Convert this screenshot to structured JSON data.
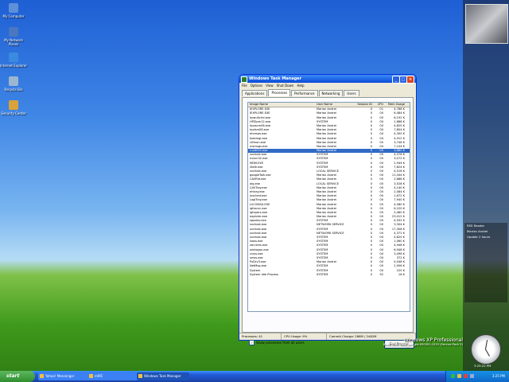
{
  "desktop_icons": [
    {
      "label": "My Computer",
      "color": "#5e8fd9"
    },
    {
      "label": "My Network Places",
      "color": "#4a77c0"
    },
    {
      "label": "Internet Explorer",
      "color": "#3a8be0"
    },
    {
      "label": "Recycle Bin",
      "color": "#9cb5d0"
    },
    {
      "label": "Security Center",
      "color": "#d9a23a"
    }
  ],
  "task_manager": {
    "title": "Windows Task Manager",
    "menu": [
      "File",
      "Options",
      "View",
      "Shut Down",
      "Help"
    ],
    "tabs": [
      "Applications",
      "Processes",
      "Performance",
      "Networking",
      "Users"
    ],
    "active_tab": "Processes",
    "columns": [
      "Image Name",
      "User Name",
      "Session ID",
      "CPU",
      "Mem Usage"
    ],
    "rows": [
      [
        "IEXPLORE.EXE",
        "Marian Andrei",
        "0",
        "01",
        "4,788 K"
      ],
      [
        "IEXPLORE.EXE",
        "Marian Andrei",
        "0",
        "00",
        "6,484 K"
      ],
      [
        "hpwuSchd.exe",
        "Marian Andrei",
        "0",
        "00",
        "6,192 K"
      ],
      [
        "HPZipm12.exe",
        "SYSTEM",
        "0",
        "00",
        "1,888 K"
      ],
      [
        "hposcm06.exe",
        "Marian Andrei",
        "0",
        "00",
        "4,820 K"
      ],
      [
        "hpdsrs08.exe",
        "Marian Andrei",
        "0",
        "00",
        "7,804 K"
      ],
      [
        "ehmsas.exe",
        "Marian Andrei",
        "0",
        "00",
        "4,300 K"
      ],
      [
        "taskmgr.exe",
        "Marian Andrei",
        "0",
        "04",
        "4,912 K"
      ],
      [
        "ctfmon.exe",
        "Marian Andrei",
        "0",
        "00",
        "3,748 K"
      ],
      [
        "msmsgs.exe",
        "Marian Andrei",
        "0",
        "00",
        "7,104 K"
      ],
      [
        "rundll32.exe",
        "Marian Andrei",
        "0",
        "00",
        "3,680 K"
      ],
      [
        "svchost.exe",
        "SYSTEM",
        "0",
        "00",
        "4,076 K"
      ],
      [
        "nvsvc32.exe",
        "SYSTEM",
        "0",
        "00",
        "3,072 K"
      ],
      [
        "MDM.EXE",
        "SYSTEM",
        "0",
        "00",
        "2,944 K"
      ],
      [
        "iSafe.exe",
        "SYSTEM",
        "0",
        "00",
        "7,624 K"
      ],
      [
        "svchost.exe",
        "LOCAL SERVICE",
        "0",
        "00",
        "4,516 K"
      ],
      [
        "googleTalk.exe",
        "Marian Andrei",
        "0",
        "00",
        "11,044 K"
      ],
      [
        "CAVRid.exe",
        "Marian Andrei",
        "0",
        "00",
        "2,688 K"
      ],
      [
        "alg.exe",
        "LOCAL SERVICE",
        "0",
        "00",
        "3,528 K"
      ],
      [
        "CAVTray.exe",
        "Marian Andrei",
        "0",
        "00",
        "4,140 K"
      ],
      [
        "ehtray.exe",
        "Marian Andrei",
        "0",
        "00",
        "2,084 K"
      ],
      [
        "jusched.exe",
        "Marian Andrei",
        "0",
        "00",
        "1,672 K"
      ],
      [
        "LogiTray.exe",
        "Marian Andrei",
        "0",
        "00",
        "7,940 K"
      ],
      [
        "LVCOMSX.EXE",
        "Marian Andrei",
        "0",
        "00",
        "4,080 K"
      ],
      [
        "igfxsrvc.exe",
        "Marian Andrei",
        "0",
        "00",
        "6,220 K"
      ],
      [
        "igfxpers.exe",
        "Marian Andrei",
        "0",
        "00",
        "5,460 K"
      ],
      [
        "explorer.exe",
        "Marian Andrei",
        "0",
        "00",
        "23,012 K"
      ],
      [
        "spoolsv.exe",
        "SYSTEM",
        "0",
        "00",
        "4,932 K"
      ],
      [
        "svchost.exe",
        "NETWORK SERVICE",
        "0",
        "00",
        "3,304 K"
      ],
      [
        "svchost.exe",
        "SYSTEM",
        "0",
        "00",
        "17,308 K"
      ],
      [
        "svchost.exe",
        "NETWORK SERVICE",
        "0",
        "00",
        "4,372 K"
      ],
      [
        "svchost.exe",
        "SYSTEM",
        "0",
        "00",
        "4,620 K"
      ],
      [
        "lsass.exe",
        "SYSTEM",
        "0",
        "00",
        "1,060 K"
      ],
      [
        "services.exe",
        "SYSTEM",
        "0",
        "00",
        "4,948 K"
      ],
      [
        "winlogon.exe",
        "SYSTEM",
        "0",
        "00",
        "6,948 K"
      ],
      [
        "csrss.exe",
        "SYSTEM",
        "0",
        "00",
        "3,496 K"
      ],
      [
        "smss.exe",
        "SYSTEM",
        "0",
        "00",
        "372 K"
      ],
      [
        "PxDrv3.exe",
        "Marian Andrei",
        "0",
        "00",
        "4,048 K"
      ],
      [
        "NetMsg.exe",
        "SYSTEM",
        "0",
        "00",
        "2,956 K"
      ],
      [
        "System",
        "SYSTEM",
        "0",
        "00",
        "220 K"
      ],
      [
        "System Idle Process",
        "SYSTEM",
        "0",
        "92",
        "16 K"
      ]
    ],
    "selected_row": 10,
    "show_all_label": "Show processes from all users",
    "show_all_checked": "✓",
    "end_process_label": "End Process",
    "status": [
      "Processes: 41",
      "CPU Usage: 9%",
      "Commit Charge: 286M / 2462M"
    ]
  },
  "sidebar": {
    "rss_title": "RSS Reader",
    "rss_items": [
      "Marian Andrei",
      "Update 2 hours"
    ],
    "clock_caption": "3:25:22 PM"
  },
  "watermark": {
    "line1": "Windows XP Professional",
    "line2": "Build 2600.xpsp_sp2_gdr.050301-1519 (Service Pack 2)"
  },
  "taskbar": {
    "start_label": "start",
    "items": [
      "Yahoo! Messenger",
      "mIRC",
      "Windows Task Manager"
    ],
    "active_item": 2,
    "time": "3:25 PM"
  }
}
